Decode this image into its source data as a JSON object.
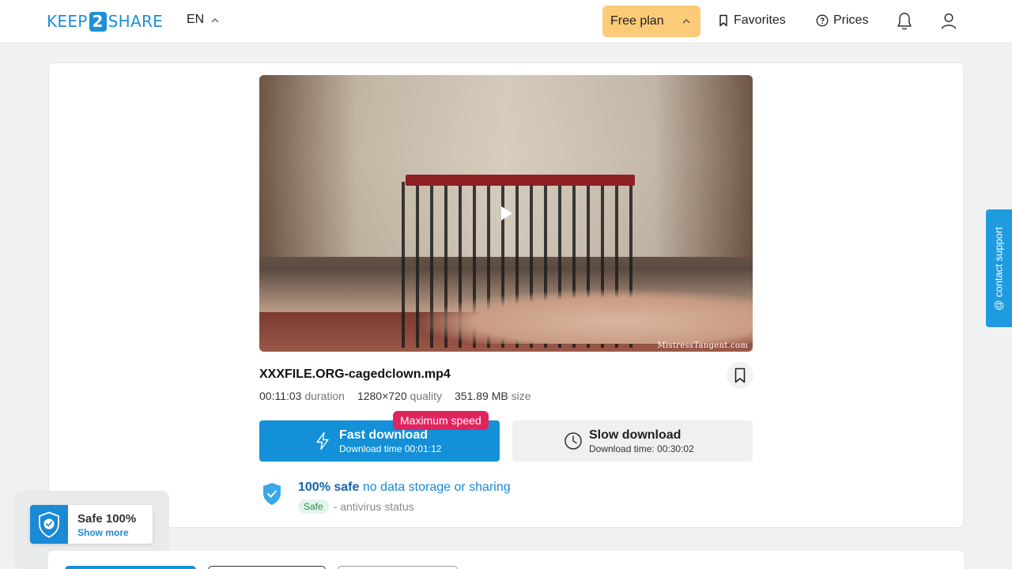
{
  "header": {
    "logo_left": "KEEP",
    "logo_mid": "2",
    "logo_right": "SHARE",
    "language": "EN",
    "plan_label": "Free plan",
    "favorites_label": "Favorites",
    "prices_label": "Prices"
  },
  "video": {
    "watermark": "MistressTangent.com"
  },
  "file": {
    "name": "XXXFILE.ORG-cagedclown.mp4",
    "duration": "00:11:03",
    "duration_label": "duration",
    "quality": "1280×720",
    "quality_label": "quality",
    "size": "351.89 MB",
    "size_label": "size"
  },
  "download": {
    "badge": "Maximum speed",
    "fast_title": "Fast download",
    "fast_time": "Download time 00:01:12",
    "slow_title": "Slow download",
    "slow_time": "Download time: 00:30:02"
  },
  "safety": {
    "bold": "100% safe",
    "text": "no data storage or sharing",
    "status_pill": "Safe",
    "status_text": "- antivirus status"
  },
  "support_label": "@ contact support",
  "popup": {
    "title": "Safe 100%",
    "link": "Show more"
  },
  "colors": {
    "accent": "#1390d8",
    "plan": "#fccb78",
    "badge": "#e0245e"
  }
}
